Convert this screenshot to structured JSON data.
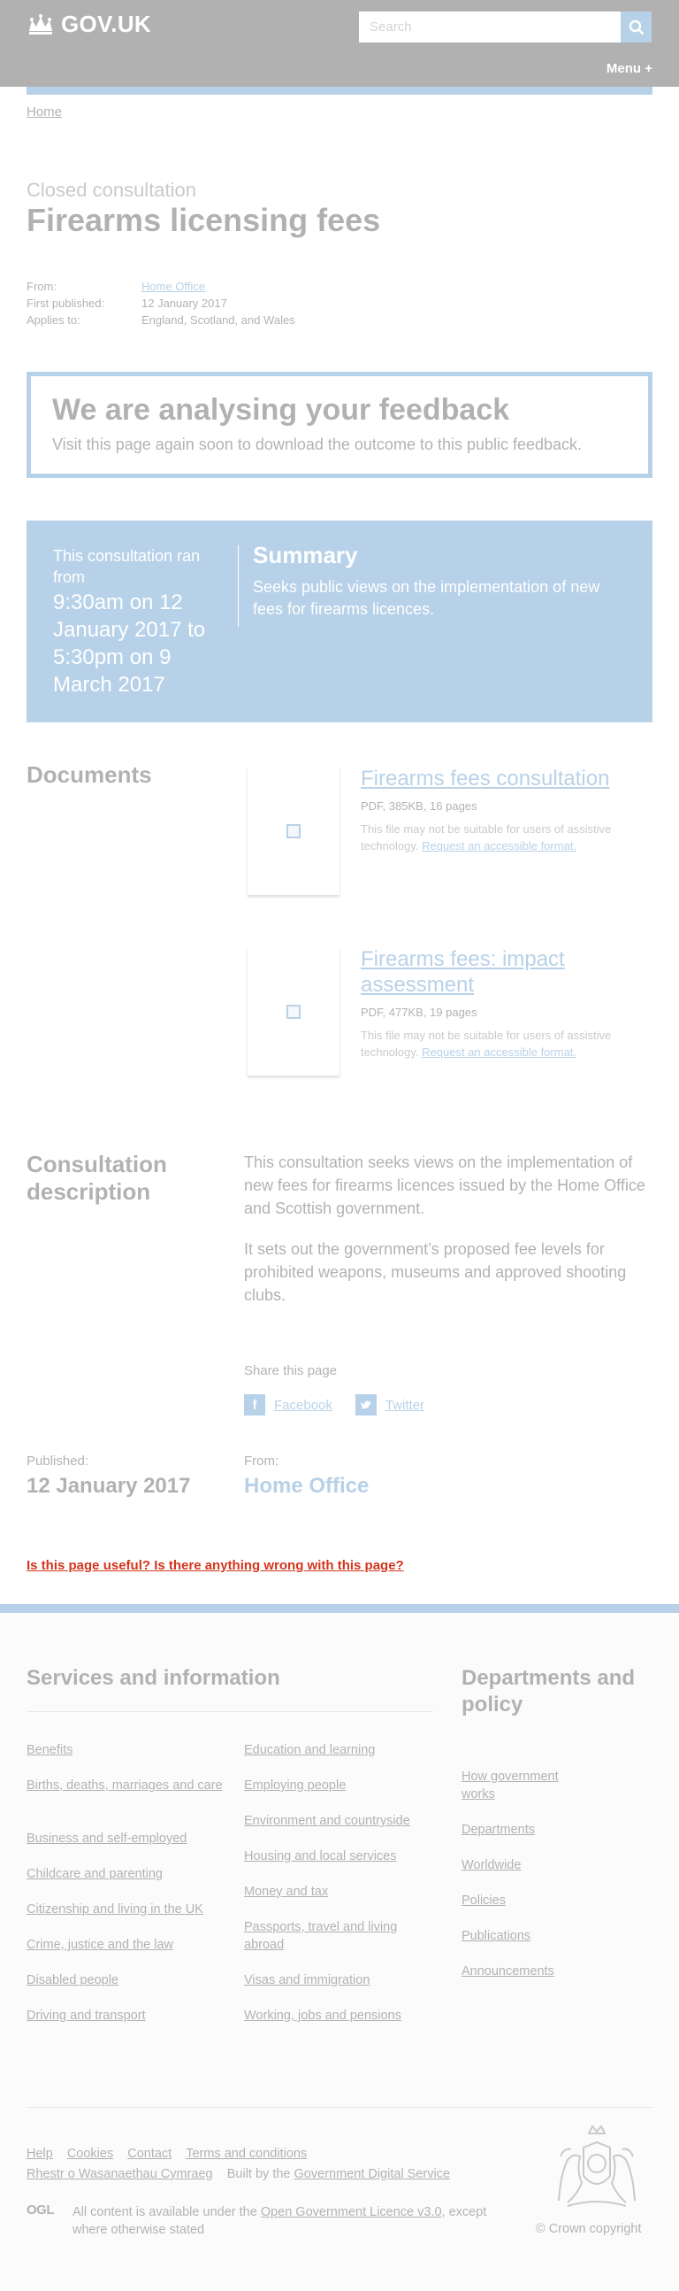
{
  "header": {
    "logo_text": "GOV.UK",
    "search_placeholder": "Search",
    "menu_label": "Menu +"
  },
  "breadcrumb": {
    "home": "Home"
  },
  "title_block": {
    "caption": "Closed consultation",
    "title": "Firearms licensing fees"
  },
  "metadata": {
    "from_label": "From:",
    "from_value": "Home Office",
    "published_label": "First published:",
    "published_value": "12 January 2017",
    "applies_label": "Applies to:",
    "applies_value": "England, Scotland, and Wales"
  },
  "outcome": {
    "title": "We are analysing your feedback",
    "text": "Visit this page again soon to download the outcome to this public feedback."
  },
  "consultation_dates": {
    "intro": "This consultation ran from",
    "range": "9:30am on 12 January 2017 to 5:30pm on 9 March 2017",
    "summary_title": "Summary",
    "summary_text": "Seeks public views on the implementation of new fees for firearms licences."
  },
  "documents": {
    "heading": "Documents",
    "items": [
      {
        "title": "Firearms fees consultation",
        "meta": "PDF, 385KB, 16 pages",
        "note": "This file may not be suitable for users of assistive technology.",
        "request_link": "Request an accessible format."
      },
      {
        "title": "Firearms fees: impact assessment",
        "meta": "PDF, 477KB, 19 pages",
        "note": "This file may not be suitable for users of assistive technology.",
        "request_link": "Request an accessible format."
      }
    ]
  },
  "description": {
    "heading": "Consultation description",
    "paragraphs": [
      "This consultation seeks views on the implementation of new fees for firearms licences issued by the Home Office and Scottish government.",
      "It sets out the government’s proposed fee levels for prohibited weapons, museums and approved shooting clubs."
    ]
  },
  "share": {
    "title": "Share this page",
    "facebook": "Facebook",
    "twitter": "Twitter"
  },
  "published_footer": {
    "published_label": "Published:",
    "published_value": "12 January 2017",
    "from_label": "From:",
    "from_value": "Home Office"
  },
  "report_link": "Is this page useful? Is there anything wrong with this page?",
  "footer": {
    "services_heading": "Services and information",
    "services_col1": [
      "Benefits",
      "Births, deaths, marriages and care",
      "Business and self-employed",
      "Childcare and parenting",
      "Citizenship and living in the UK",
      "Crime, justice and the law",
      "Disabled people",
      "Driving and transport"
    ],
    "services_col2": [
      "Education and learning",
      "Employing people",
      "Environment and countryside",
      "Housing and local services",
      "Money and tax",
      "Passports, travel and living abroad",
      "Visas and immigration",
      "Working, jobs and pensions"
    ],
    "departments_heading": "Departments and policy",
    "departments_links": [
      "How government works",
      "Departments",
      "Worldwide",
      "Policies",
      "Publications",
      "Announcements"
    ],
    "meta_links": [
      "Help",
      "Cookies",
      "Contact",
      "Terms and conditions"
    ],
    "welsh_link": "Rhestr o Wasanaethau Cymraeg",
    "built_by_prefix": "Built by the",
    "built_by_link": "Government Digital Service",
    "ogl_badge": "OGL",
    "licence_prefix": "All content is available under the",
    "licence_link": "Open Government Licence v3.0",
    "licence_suffix": ", except where otherwise stated",
    "copyright": "© Crown copyright"
  },
  "colors": {
    "header_bg": "#0b0c0c",
    "link": "#1d70b8",
    "accent_blue": "#1d70b8",
    "report_red": "#d4351c",
    "footer_bg": "#f3f2f1"
  }
}
